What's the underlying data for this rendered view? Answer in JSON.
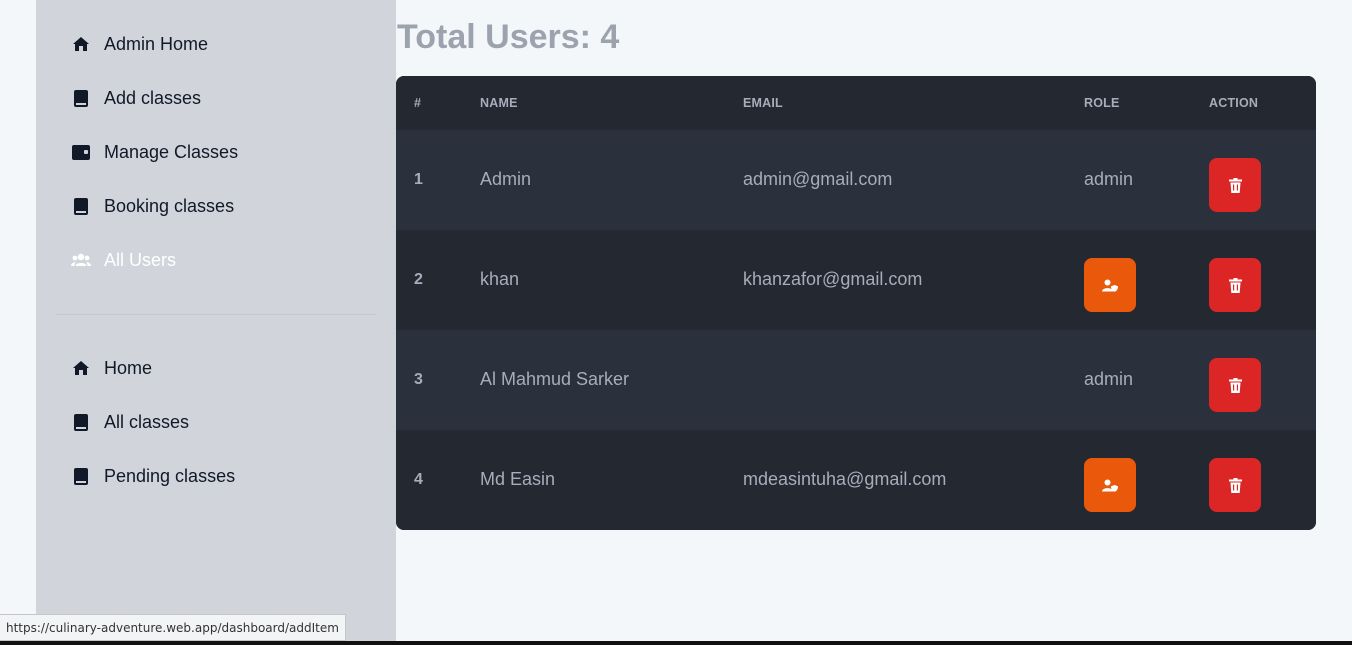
{
  "sidebar": {
    "admin_items": [
      {
        "label": "Admin Home",
        "icon": "home-icon"
      },
      {
        "label": "Add classes",
        "icon": "book-icon"
      },
      {
        "label": "Manage Classes",
        "icon": "wallet-icon"
      },
      {
        "label": "Booking classes",
        "icon": "book-icon"
      },
      {
        "label": "All Users",
        "icon": "users-icon",
        "active": true
      }
    ],
    "general_items": [
      {
        "label": "Home",
        "icon": "home-icon"
      },
      {
        "label": "All classes",
        "icon": "book-icon"
      },
      {
        "label": "Pending classes",
        "icon": "book-icon"
      }
    ]
  },
  "main": {
    "title": "Total Users: 4",
    "table": {
      "headers": [
        "#",
        "NAME",
        "EMAIL",
        "ROLE",
        "ACTION"
      ],
      "rows": [
        {
          "num": "1",
          "name": "Admin",
          "email": "admin@gmail.com",
          "role": "admin",
          "role_button": false
        },
        {
          "num": "2",
          "name": "khan",
          "email": "khanzafor@gmail.com",
          "role": "",
          "role_button": true
        },
        {
          "num": "3",
          "name": "Al Mahmud Sarker",
          "email": "",
          "role": "admin",
          "role_button": false
        },
        {
          "num": "4",
          "name": "Md Easin",
          "email": "mdeasintuha@gmail.com",
          "role": "",
          "role_button": true
        }
      ]
    }
  },
  "statusbar": {
    "url": "https://culinary-adventure.web.app/dashboard/addItem"
  },
  "colors": {
    "delete": "#dc2626",
    "make_admin": "#ea580c",
    "table_bg": "#242830",
    "sidebar_bg": "#d1d5db"
  }
}
